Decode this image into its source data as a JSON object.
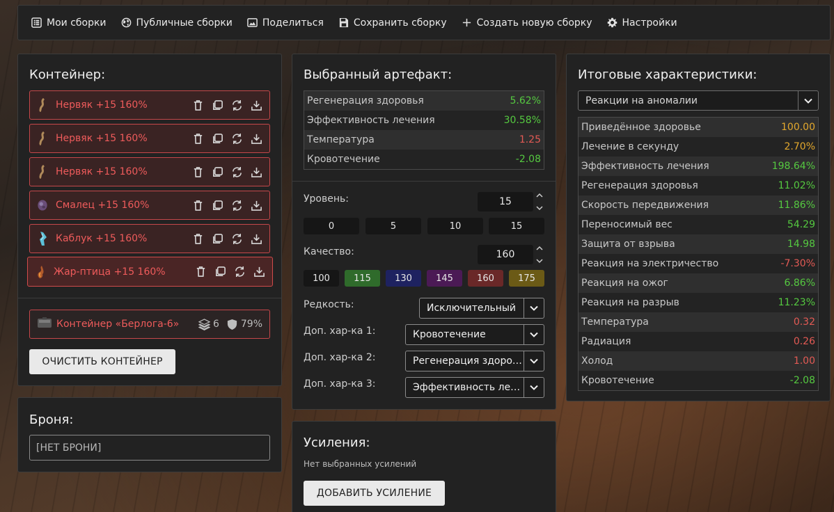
{
  "nav": {
    "my_builds": "Мои сборки",
    "public_builds": "Публичные сборки",
    "share": "Поделиться",
    "save": "Сохранить сборку",
    "create": "Создать новую сборку",
    "settings": "Настройки"
  },
  "container": {
    "title": "Контейнер:",
    "items": [
      {
        "name": "Нервяк +15 160%",
        "icon": "nervyak-artifact-icon"
      },
      {
        "name": "Нервяк +15 160%",
        "icon": "nervyak-artifact-icon"
      },
      {
        "name": "Нервяк +15 160%",
        "icon": "nervyak-artifact-icon"
      },
      {
        "name": "Смалец +15 160%",
        "icon": "smalets-artifact-icon"
      },
      {
        "name": "Каблук +15 160%",
        "icon": "kabluk-artifact-icon"
      },
      {
        "name": "Жар-птица +15 160%",
        "icon": "zhar-ptitsa-artifact-icon"
      }
    ],
    "container_name": "Контейнер «Берлога-6»",
    "slots": "6",
    "protection": "79%",
    "clear_button": "ОЧИСТИТЬ КОНТЕЙНЕР"
  },
  "armor": {
    "title": "Броня:",
    "value": "[НЕТ БРОНИ]"
  },
  "artifact": {
    "title": "Выбранный артефакт:",
    "stats": [
      {
        "label": "Регенерация здоровья",
        "value": "5.62%",
        "tone": "pos"
      },
      {
        "label": "Эффективность лечения",
        "value": "30.58%",
        "tone": "pos"
      },
      {
        "label": "Температура",
        "value": "1.25",
        "tone": "neg"
      },
      {
        "label": "Кровотечение",
        "value": "-2.08",
        "tone": "pos"
      }
    ],
    "level_label": "Уровень:",
    "level_value": "15",
    "level_presets": [
      "0",
      "5",
      "10",
      "15"
    ],
    "quality_label": "Качество:",
    "quality_value": "160",
    "quality_presets": [
      {
        "label": "100",
        "color": "#161616"
      },
      {
        "label": "115",
        "color": "#2f6b2b"
      },
      {
        "label": "130",
        "color": "#1e2260"
      },
      {
        "label": "145",
        "color": "#4b1a55"
      },
      {
        "label": "160",
        "color": "#6a2828"
      },
      {
        "label": "175",
        "color": "#6b5a16"
      }
    ],
    "rarity_label": "Редкость:",
    "rarity_value": "Исключительный",
    "extra1_label": "Доп. хар-ка 1:",
    "extra1_value": "Кровотечение",
    "extra2_label": "Доп. хар-ка 2:",
    "extra2_value": "Регенерация здоровья",
    "extra3_label": "Доп. хар-ка 3:",
    "extra3_value": "Эффективность лечения"
  },
  "boosts": {
    "title": "Усиления:",
    "empty_text": "Нет выбранных усилений",
    "add_button": "ДОБАВИТЬ УСИЛЕНИЕ"
  },
  "totals": {
    "title": "Итоговые характеристики:",
    "filter_value": "Реакции на аномалии",
    "stats": [
      {
        "label": "Приведённое здоровье",
        "value": "100.00",
        "tone": "gold"
      },
      {
        "label": "Лечение в секунду",
        "value": "2.70%",
        "tone": "gold"
      },
      {
        "label": "Эффективность лечения",
        "value": "198.64%",
        "tone": "pos"
      },
      {
        "label": "Регенерация здоровья",
        "value": "11.02%",
        "tone": "pos"
      },
      {
        "label": "Скорость передвижения",
        "value": "11.86%",
        "tone": "pos"
      },
      {
        "label": "Переносимый вес",
        "value": "54.29",
        "tone": "pos"
      },
      {
        "label": "Защита от взрыва",
        "value": "14.98",
        "tone": "pos"
      },
      {
        "label": "Реакция на электричество",
        "value": "-7.30%",
        "tone": "neg"
      },
      {
        "label": "Реакция на ожог",
        "value": "6.86%",
        "tone": "pos"
      },
      {
        "label": "Реакция на разрыв",
        "value": "11.23%",
        "tone": "pos"
      },
      {
        "label": "Температура",
        "value": "0.32",
        "tone": "neg"
      },
      {
        "label": "Радиация",
        "value": "0.26",
        "tone": "neg"
      },
      {
        "label": "Холод",
        "value": "1.00",
        "tone": "neg"
      },
      {
        "label": "Кровотечение",
        "value": "-2.08",
        "tone": "pos"
      }
    ]
  }
}
